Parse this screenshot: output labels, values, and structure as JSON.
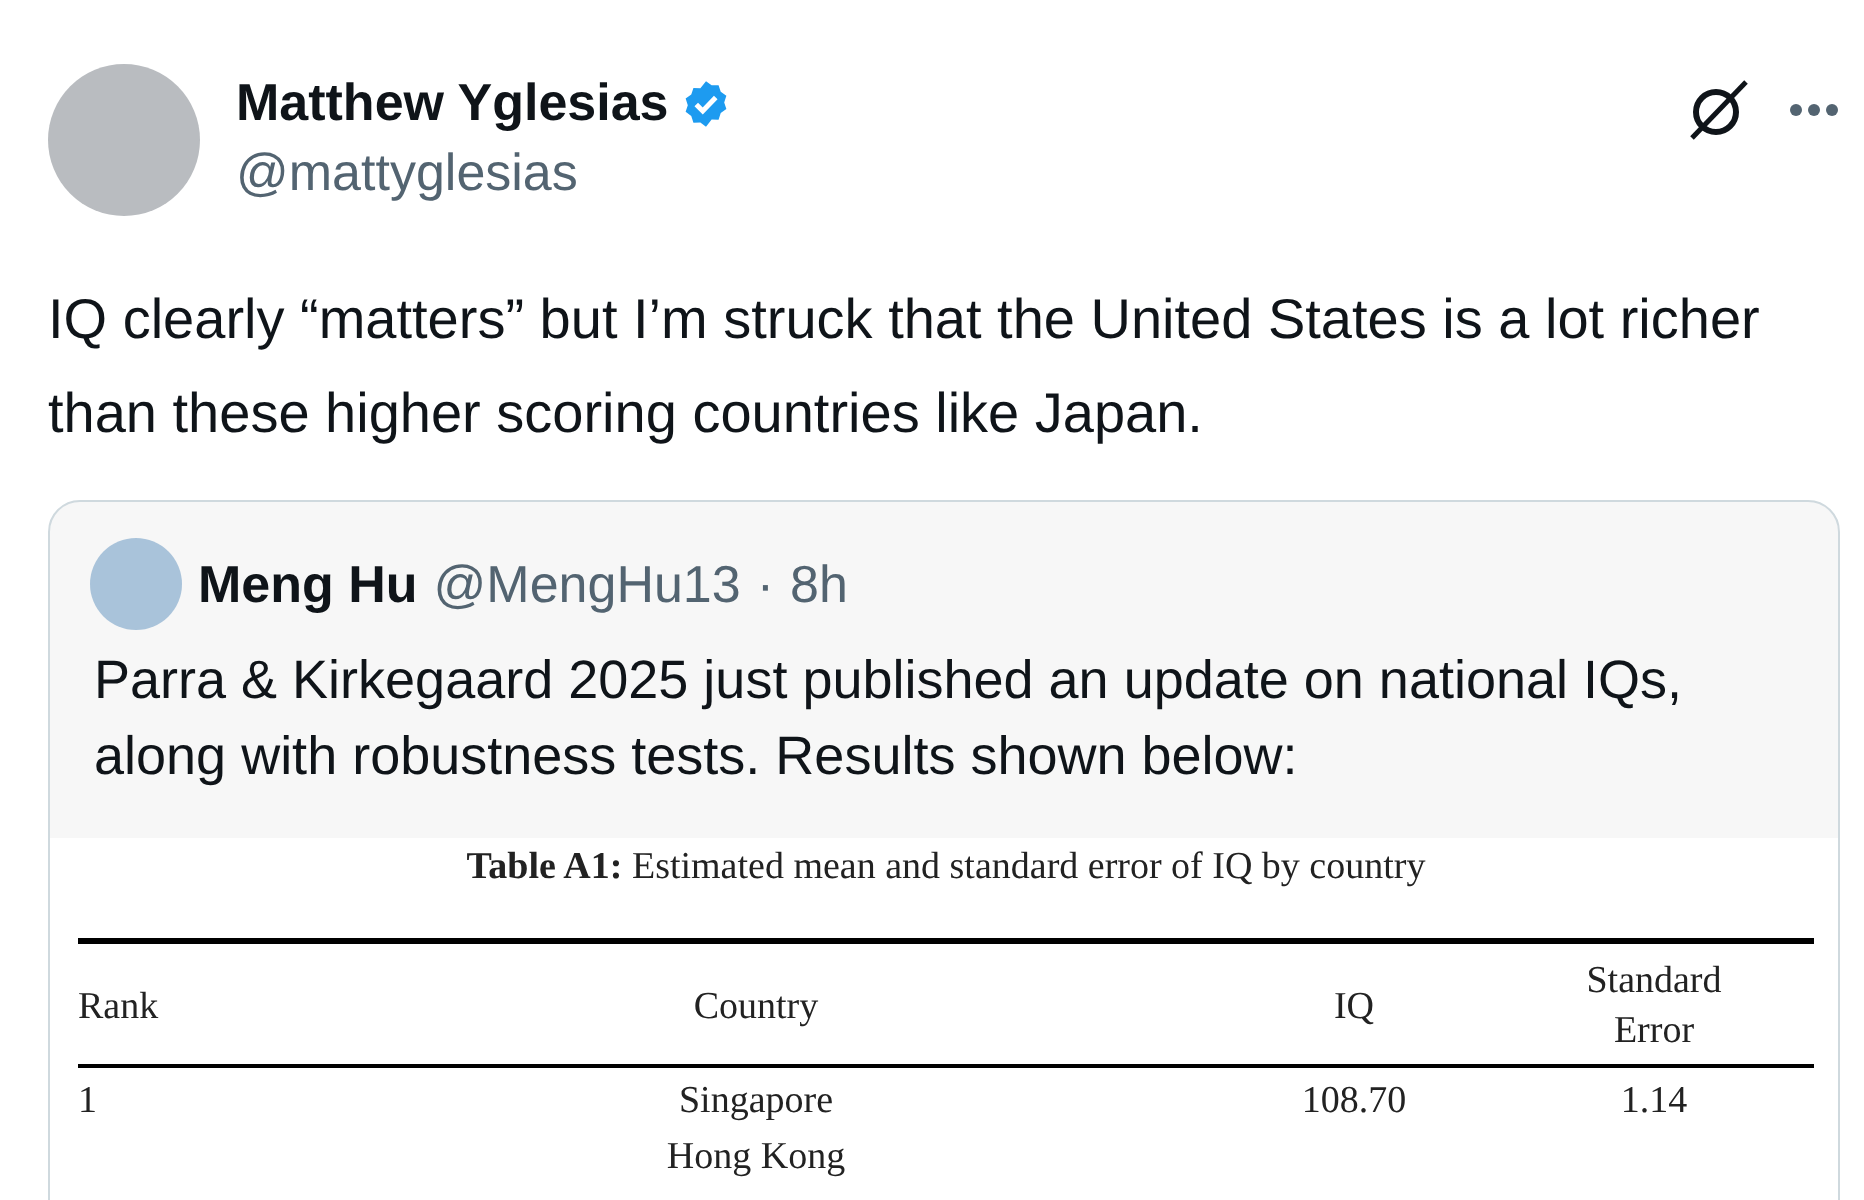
{
  "author": {
    "name": "Matthew Yglesias",
    "handle": "@mattyglesias",
    "verified": true
  },
  "text": "IQ clearly “matters” but I’m struck that the United States is a lot richer than these higher scoring countries like Japan.",
  "quote": {
    "name": "Meng Hu",
    "handle": "@MengHu13",
    "separator": "·",
    "time": "8h",
    "text": "Parra & Kirkegaard 2025 just published an update on national IQs, along with robustness tests. Results shown below:",
    "table": {
      "caption": "**Table A1:** Estimated mean and standard error of IQ by country",
      "columns": [
        "Rank",
        "Country",
        "IQ",
        "Standard Error"
      ],
      "rows": [
        [
          "1",
          "Singapore",
          "108.70",
          "1.14"
        ],
        [
          "",
          "Hong Kong",
          "",
          ""
        ]
      ]
    }
  }
}
